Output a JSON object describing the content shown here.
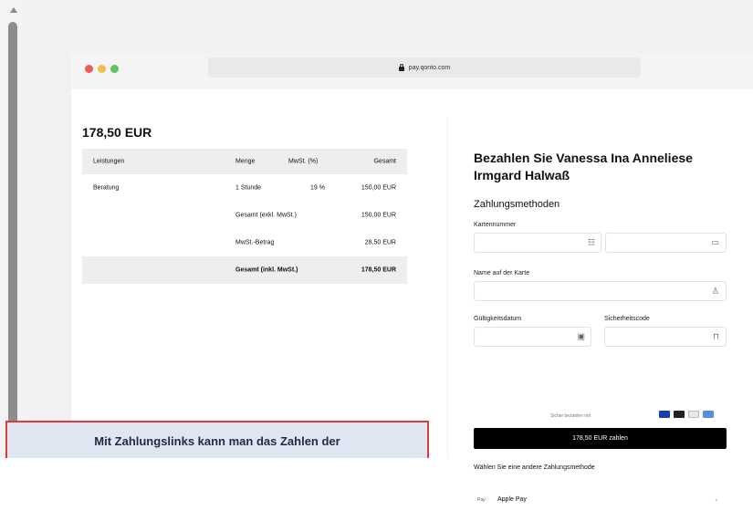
{
  "browser": {
    "url": "pay.qonto.com"
  },
  "invoice": {
    "amount": "178,50 EUR",
    "headers": {
      "description": "Leistungen",
      "quantity": "Menge",
      "vat": "MwSt. (%)",
      "total": "Gesamt"
    },
    "item": {
      "description": "Beratung",
      "quantity": "1 Stunde",
      "vat": "19 %",
      "total": "150,00 EUR"
    },
    "subtotal": {
      "label": "Gesamt (exkl. MwSt.)",
      "value": "150,00 EUR"
    },
    "vat_amount": {
      "label": "MwSt.-Betrag",
      "value": "28,50 EUR"
    },
    "grand_total": {
      "label": "Gesamt (inkl. MwSt.)",
      "value": "178,50 EUR"
    }
  },
  "payment": {
    "title": "Bezahlen Sie Vanessa Ina Anneliese Irmgard Halwaß",
    "methods_heading": "Zahlungsmethoden",
    "card_number_label": "Kartennummer",
    "card_name_label": "Name auf der Karte",
    "expiry_label": "Gültigkeitsdatum",
    "cvc_label": "Sicherheitscode",
    "secure_note": "Sicher bezahlen mit",
    "pay_button": "178,50 EUR zahlen",
    "alt_heading": "Wählen Sie eine andere Zahlungsmethode",
    "apple_tag": "Pay",
    "apple_label": "Apple Pay"
  },
  "caption": {
    "text": "Mit Zahlungslinks kann man das Zahlen der"
  },
  "colors": {
    "accent": "#000000",
    "caption_border": "#e03b3b",
    "caption_bg": "#dfe6f2"
  }
}
